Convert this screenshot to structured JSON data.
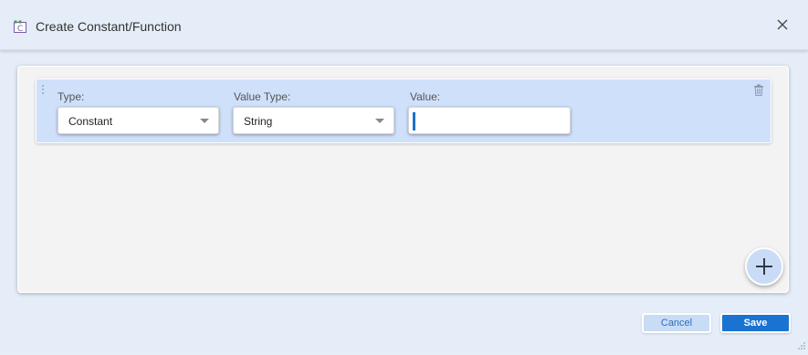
{
  "dialog": {
    "title": "Create Constant/Function",
    "title_icon": "constant-function-icon",
    "close_icon": "close-icon"
  },
  "row": {
    "drag_icon": "drag-handle-icon",
    "delete_icon": "trash-icon",
    "type": {
      "label": "Type:",
      "value": "Constant"
    },
    "value_type": {
      "label": "Value Type:",
      "value": "String"
    },
    "value": {
      "label": "Value:",
      "current": ""
    }
  },
  "add_icon": "plus-icon",
  "footer": {
    "cancel_label": "Cancel",
    "save_label": "Save"
  },
  "colors": {
    "accent": "#1a73d1",
    "row_background": "#cfe0fb",
    "dialog_background": "#e4edf8"
  }
}
